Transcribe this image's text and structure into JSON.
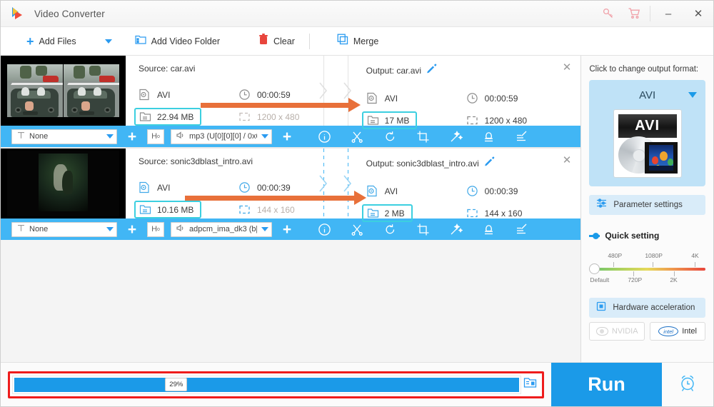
{
  "window": {
    "title": "Video Converter",
    "controls": {
      "key": "key-icon",
      "cart": "cart-icon",
      "minimize": "–",
      "close": "✕"
    }
  },
  "toolbar": {
    "add_files": "Add Files",
    "add_video_folder": "Add Video Folder",
    "clear": "Clear",
    "merge": "Merge"
  },
  "files": [
    {
      "source": {
        "title": "Source: car.avi",
        "format": "AVI",
        "duration": "00:00:59",
        "size": "22.94 MB",
        "resolution": "1200 x 480"
      },
      "output": {
        "title": "Output: car.avi",
        "format": "AVI",
        "duration": "00:00:59",
        "size": "17 MB",
        "resolution": "1200 x 480"
      },
      "actions": {
        "subtitle": "None",
        "audio": "mp3 (U[0][0][0] / 0x0(",
        "hdr_label": "H"
      }
    },
    {
      "source": {
        "title": "Source: sonic3dblast_intro.avi",
        "format": "AVI",
        "duration": "00:00:39",
        "size": "10.16 MB",
        "resolution": "144 x 160"
      },
      "output": {
        "title": "Output: sonic3dblast_intro.avi",
        "format": "AVI",
        "duration": "00:00:39",
        "size": "2 MB",
        "resolution": "144 x 160"
      },
      "actions": {
        "subtitle": "None",
        "audio": "adpcm_ima_dk3 (b[",
        "hdr_label": "H"
      }
    }
  ],
  "action_icons": [
    "info-icon",
    "cut-icon",
    "rotate-icon",
    "crop-icon",
    "effects-icon",
    "watermark-icon",
    "edit-icon"
  ],
  "right_panel": {
    "prompt": "Click to change output format:",
    "format": "AVI",
    "format_badge": "AVI",
    "parameter_settings": "Parameter settings",
    "quick_setting": "Quick setting",
    "slider": {
      "top_labels": [
        "480P",
        "1080P",
        "4K"
      ],
      "bottom_labels": [
        "Default",
        "720P",
        "2K"
      ]
    },
    "hardware_acceleration": "Hardware acceleration",
    "gpu": {
      "nvidia": "NVIDIA",
      "intel": "Intel"
    }
  },
  "bottom": {
    "progress_percent": "29%",
    "progress_value": 29,
    "run": "Run",
    "alarm": "alarm-icon"
  },
  "colors": {
    "accent_blue": "#1b9ae8",
    "action_bar_blue": "#41b6f5",
    "highlight_cyan": "#3ccfe0",
    "arrow_orange": "#e8703a",
    "alert_red": "#ee1c1c"
  }
}
